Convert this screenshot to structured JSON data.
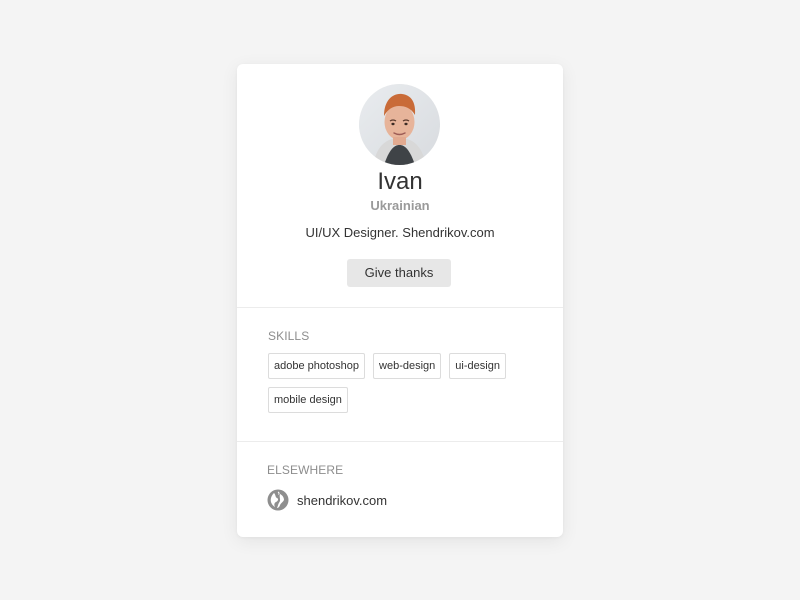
{
  "profile": {
    "name": "Ivan",
    "nationality": "Ukrainian",
    "bio": "UI/UX Designer. Shendrikov.com",
    "thanks_button": "Give thanks",
    "avatar_icon": "person-avatar"
  },
  "skills": {
    "title": "SKILLS",
    "items": [
      "adobe photoshop",
      "web-design",
      "ui-design",
      "mobile design"
    ]
  },
  "elsewhere": {
    "title": "ELSEWHERE",
    "link_text": "shendrikov.com",
    "link_icon": "globe-icon"
  },
  "colors": {
    "background": "#f4f4f4",
    "card": "#ffffff",
    "muted_text": "#9a9a9a",
    "button": "#e7e7e7"
  }
}
